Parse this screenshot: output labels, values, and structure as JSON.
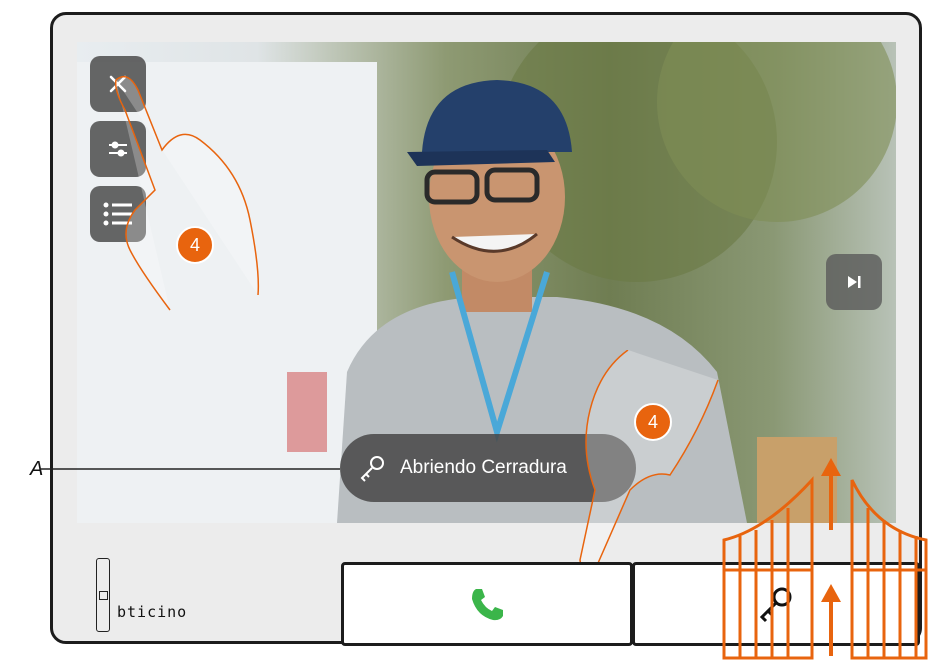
{
  "screen": {
    "toast": {
      "label": "Abriendo Cerradura",
      "icon": "key-icon"
    },
    "side_buttons": [
      "close-icon",
      "sliders-icon",
      "list-icon"
    ],
    "next_button_icon": "skip-next-icon"
  },
  "annotations": {
    "callout_letter": "A",
    "step_badge_top": "4",
    "step_badge_bottom": "4"
  },
  "device": {
    "brand": "bticino",
    "buttons": [
      "phone-icon",
      "key-icon"
    ]
  },
  "colors": {
    "accent_orange": "#e8640e",
    "phone_green": "#3bb54a",
    "overlay_gray": "#464646"
  }
}
